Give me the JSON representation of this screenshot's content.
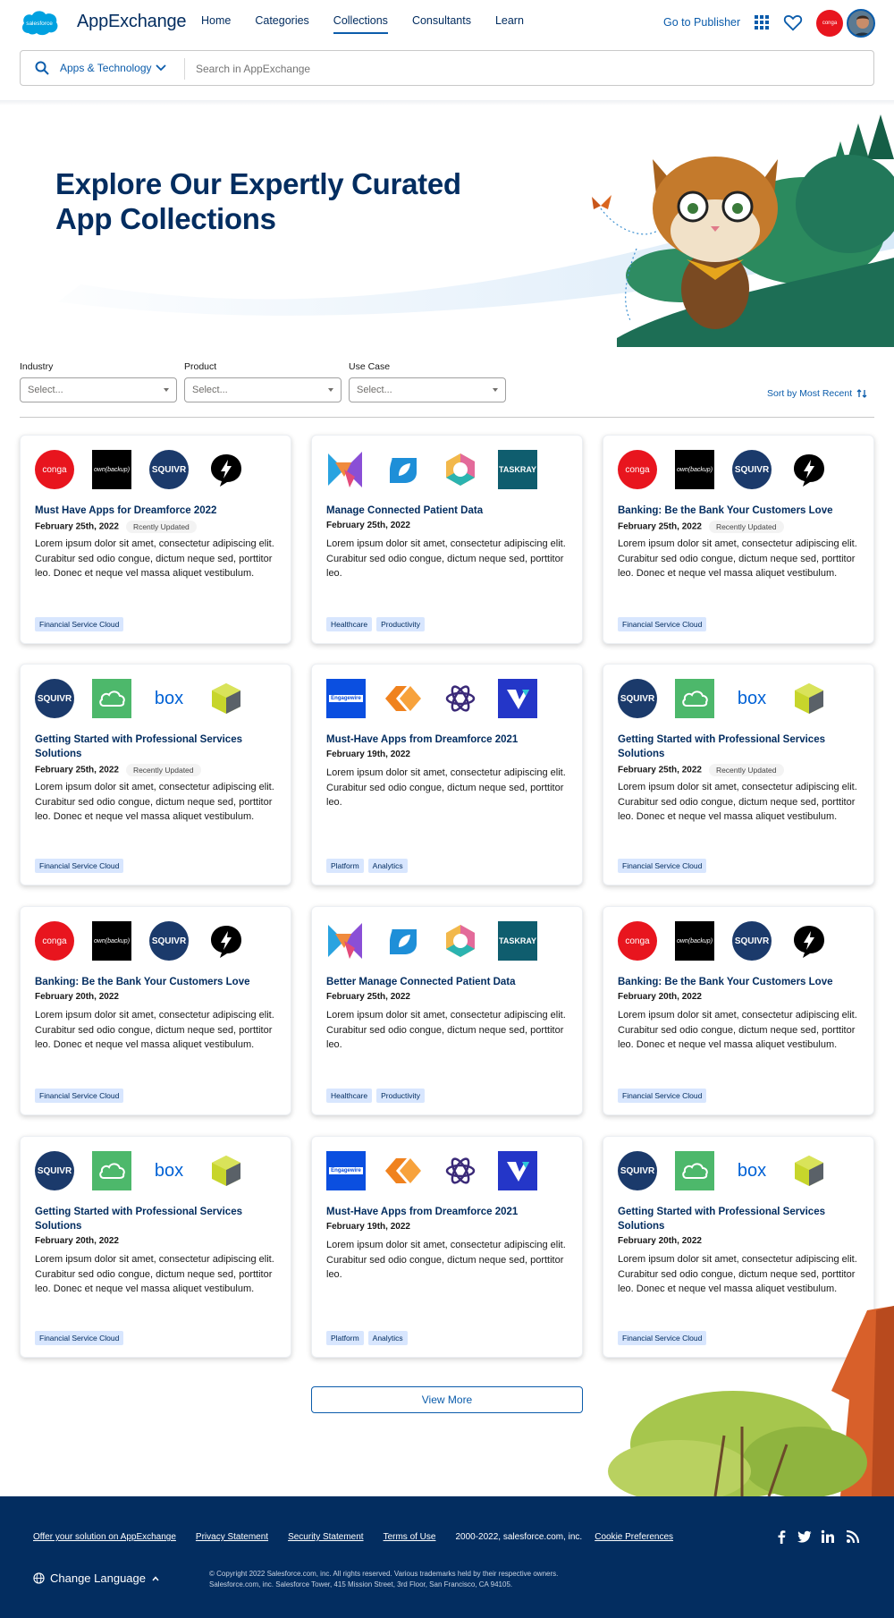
{
  "header": {
    "logo_text": "salesforce",
    "brand": "AppExchange",
    "nav": [
      "Home",
      "Categories",
      "Collections",
      "Consultants",
      "Learn"
    ],
    "go_to_publisher": "Go to Publisher",
    "avatar_label": "conga"
  },
  "search": {
    "category": "Apps & Technology",
    "placeholder": "Search in AppExchange"
  },
  "hero": {
    "title": "Explore Our Expertly Curated App Collections"
  },
  "filters": {
    "industry": {
      "label": "Industry",
      "value": "Select..."
    },
    "product": {
      "label": "Product",
      "value": "Select..."
    },
    "use_case": {
      "label": "Use Case",
      "value": "Select..."
    },
    "sort": "Sort by Most Recent"
  },
  "cards": [
    {
      "title": "Must Have Apps for Dreamforce 2022",
      "date": "February 25th, 2022",
      "badge": "Rcently Updated",
      "desc": "Lorem ipsum dolor sit amet, consectetur adipiscing elit. Curabitur sed odio congue, dictum neque sed, porttitor leo. Donec et neque vel massa aliquet vestibulum.",
      "tags": [
        "Financial Service Cloud"
      ],
      "logos": [
        "conga",
        "own(backup)",
        "SQUIVR",
        "bolt"
      ]
    },
    {
      "title": "Manage Connected Patient Data",
      "date": "February 25th, 2022",
      "badge": "",
      "desc": "Lorem ipsum dolor sit amet, consectetur adipiscing elit. Curabitur sed odio congue, dictum neque sed, porttitor leo.",
      "tags": [
        "Healthcare",
        "Productivity"
      ],
      "logos": [
        "kite",
        "leaf",
        "hex",
        "TASKRAY"
      ]
    },
    {
      "title": "Banking: Be the Bank Your Customers Love",
      "date": "February 25th, 2022",
      "badge": "Recently Updated",
      "desc": "Lorem ipsum dolor sit amet, consectetur adipiscing elit. Curabitur sed odio congue, dictum neque sed, porttitor leo. Donec et neque vel massa aliquet vestibulum.",
      "tags": [
        "Financial Service Cloud"
      ],
      "logos": [
        "conga",
        "own(backup)",
        "SQUIVR",
        "bolt"
      ]
    },
    {
      "title": "Getting Started with Professional Services Solutions",
      "date": "February 25th, 2022",
      "badge": "Recently Updated",
      "desc": "Lorem ipsum dolor sit amet, consectetur adipiscing elit. Curabitur sed odio congue, dictum neque sed, porttitor leo. Donec et neque vel massa aliquet vestibulum.",
      "tags": [
        "Financial Service Cloud"
      ],
      "logos": [
        "SQUIVR",
        "cloud",
        "box",
        "cube"
      ]
    },
    {
      "title": "Must-Have Apps from Dreamforce 2021",
      "date": "February 19th, 2022",
      "badge": "",
      "desc": "Lorem ipsum dolor sit amet, consectetur adipiscing elit. Curabitur sed odio congue, dictum neque sed, porttitor leo.",
      "tags": [
        "Platform",
        "Analytics"
      ],
      "logos": [
        "Engagewire",
        "chevrons",
        "atom",
        "V"
      ]
    },
    {
      "title": "Getting Started with Professional Services Solutions",
      "date": "February 25th, 2022",
      "badge": "Recently Updated",
      "desc": "Lorem ipsum dolor sit amet, consectetur adipiscing elit. Curabitur sed odio congue, dictum neque sed, porttitor leo. Donec et neque vel massa aliquet vestibulum.",
      "tags": [
        "Financial Service Cloud"
      ],
      "logos": [
        "SQUIVR",
        "cloud",
        "box",
        "cube"
      ]
    },
    {
      "title": "Banking: Be the Bank Your Customers Love",
      "date": "February 20th, 2022",
      "badge": "",
      "desc": "Lorem ipsum dolor sit amet, consectetur adipiscing elit. Curabitur sed odio congue, dictum neque sed, porttitor leo. Donec et neque vel massa aliquet vestibulum.",
      "tags": [
        "Financial Service Cloud"
      ],
      "logos": [
        "conga",
        "own(backup)",
        "SQUIVR",
        "bolt"
      ]
    },
    {
      "title": "Better Manage Connected Patient Data",
      "date": "February 25th, 2022",
      "badge": "",
      "desc": "Lorem ipsum dolor sit amet, consectetur adipiscing elit. Curabitur sed odio congue, dictum neque sed, porttitor leo.",
      "tags": [
        "Healthcare",
        "Productivity"
      ],
      "logos": [
        "kite",
        "leaf",
        "hex",
        "TASKRAY"
      ]
    },
    {
      "title": "Banking: Be the Bank Your Customers Love",
      "date": "February 20th, 2022",
      "badge": "",
      "desc": "Lorem ipsum dolor sit amet, consectetur adipiscing elit. Curabitur sed odio congue, dictum neque sed, porttitor leo. Donec et neque vel massa aliquet vestibulum.",
      "tags": [
        "Financial Service Cloud"
      ],
      "logos": [
        "conga",
        "own(backup)",
        "SQUIVR",
        "bolt"
      ]
    },
    {
      "title": "Getting Started with Professional Services Solutions",
      "date": "February 20th, 2022",
      "badge": "",
      "desc": "Lorem ipsum dolor sit amet, consectetur adipiscing elit. Curabitur sed odio congue, dictum neque sed, porttitor leo. Donec et neque vel massa aliquet vestibulum.",
      "tags": [
        "Financial Service Cloud"
      ],
      "logos": [
        "SQUIVR",
        "cloud",
        "box",
        "cube"
      ]
    },
    {
      "title": "Must-Have Apps from Dreamforce 2021",
      "date": "February 19th, 2022",
      "badge": "",
      "desc": "Lorem ipsum dolor sit amet, consectetur adipiscing elit. Curabitur sed odio congue, dictum neque sed, porttitor leo.",
      "tags": [
        "Platform",
        "Analytics"
      ],
      "logos": [
        "Engagewire",
        "chevrons",
        "atom",
        "V"
      ]
    },
    {
      "title": "Getting Started with Professional Services Solutions",
      "date": "February 20th, 2022",
      "badge": "",
      "desc": "Lorem ipsum dolor sit amet, consectetur adipiscing elit. Curabitur sed odio congue, dictum neque sed, porttitor leo. Donec et neque vel massa aliquet vestibulum.",
      "tags": [
        "Financial Service Cloud"
      ],
      "logos": [
        "SQUIVR",
        "cloud",
        "box",
        "cube"
      ]
    }
  ],
  "view_more": "View More",
  "footer": {
    "links": [
      "Offer your solution on AppExchange",
      "Privacy Statement",
      "Security Statement",
      "Terms of Use"
    ],
    "years": "2000-2022, salesforce.com, inc.",
    "cookie": "Cookie Preferences",
    "change_language": "Change Language",
    "copyright_1": "© Copyright 2022 Salesforce.com, inc. All rights reserved. Various trademarks held by their respective owners.",
    "copyright_2": "Salesforce.com, inc. Salesforce Tower, 415 Mission Street, 3rd Floor, San Francisco, CA 94105."
  },
  "colors": {
    "brand_blue": "#0b5cab",
    "navy": "#032d60",
    "tag_bg": "#d8e6fe",
    "conga_red": "#e8151e"
  }
}
